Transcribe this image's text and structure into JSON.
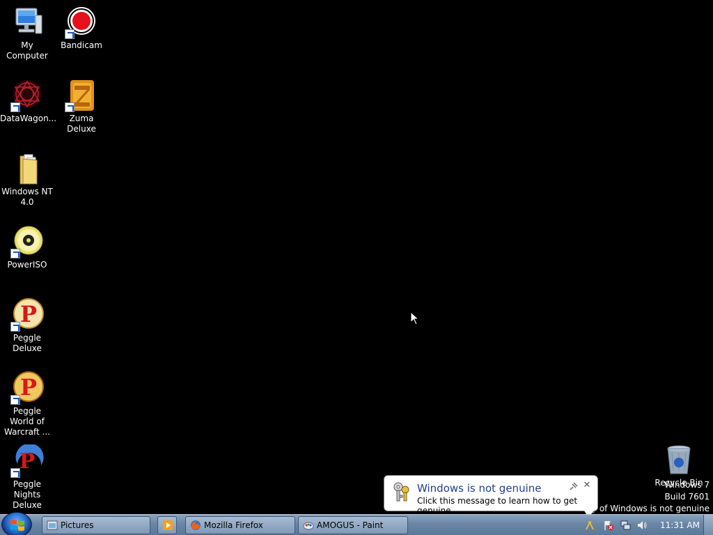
{
  "desktop": {
    "icons": [
      {
        "label": "My Computer",
        "icon": "computer-icon"
      },
      {
        "label": "Bandicam",
        "icon": "bandicam-icon"
      },
      {
        "label": "DataWagon...",
        "icon": "datawagon-icon"
      },
      {
        "label": "Zuma Deluxe",
        "icon": "zuma-icon"
      },
      {
        "label": "Windows NT 4.0",
        "icon": "folder-icon"
      },
      {
        "label": "PowerISO",
        "icon": "disc-icon"
      },
      {
        "label": "Peggle Deluxe",
        "icon": "peggle-icon"
      },
      {
        "label": "Peggle World of Warcraft ...",
        "icon": "peggle-icon"
      },
      {
        "label": "Peggle Nights Deluxe",
        "icon": "peggle-nights-icon"
      },
      {
        "label": "Recycle Bin",
        "icon": "recycle-bin-icon"
      }
    ]
  },
  "watermark": {
    "line1": "Windows 7",
    "line2": "Build 7601",
    "line3": "This copy of Windows is not genuine"
  },
  "balloon": {
    "title": "Windows is not genuine",
    "text": "Click this message to learn how to get genuine.",
    "close": "✕"
  },
  "taskbar": {
    "tasks": [
      {
        "label": "Pictures",
        "icon": "folder-window-icon"
      },
      {
        "label": "Mozilla Firefox",
        "icon": "firefox-icon"
      },
      {
        "label": "AMOGUS - Paint",
        "icon": "paint-icon"
      }
    ],
    "quick_launch": "media-player-icon",
    "clock": "11:31 AM"
  },
  "colors": {
    "desktop_bg": "#000000",
    "taskbar": "#6a86a6",
    "balloon_title": "#1f3f8f"
  }
}
